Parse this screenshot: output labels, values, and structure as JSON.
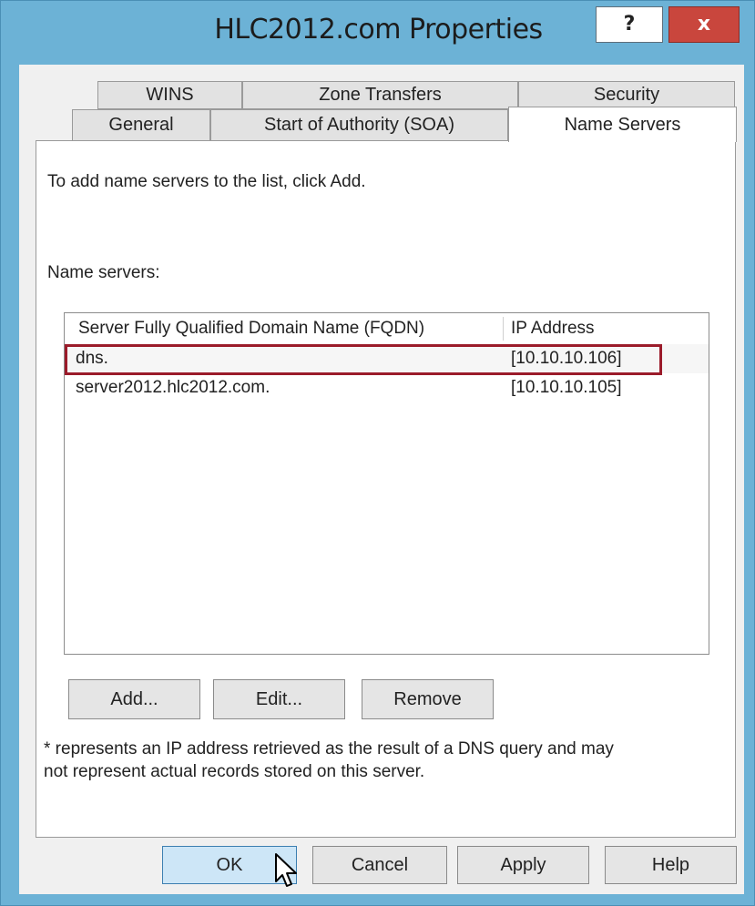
{
  "window": {
    "title": "HLC2012.com Properties",
    "help_label": "?",
    "close_label": "x"
  },
  "tabs": {
    "row1": [
      "WINS",
      "Zone Transfers",
      "Security"
    ],
    "row2": [
      "General",
      "Start of Authority (SOA)",
      "Name Servers"
    ],
    "selected": "Name Servers"
  },
  "panel": {
    "instruction": "To add name servers to the list, click Add.",
    "list_label": "Name servers:",
    "columns": [
      "Server Fully Qualified Domain Name (FQDN)",
      "IP Address"
    ],
    "rows": [
      {
        "fqdn": "dns.",
        "ip": "[10.10.10.106]",
        "selected": true
      },
      {
        "fqdn": "server2012.hlc2012.com.",
        "ip": "[10.10.10.105]",
        "selected": false
      }
    ],
    "buttons": {
      "add": "Add...",
      "edit": "Edit...",
      "remove": "Remove"
    },
    "note_line1": "* represents an IP address retrieved as the result of a DNS query and may",
    "note_line2": "not represent actual records stored on this server."
  },
  "footer": {
    "ok": "OK",
    "cancel": "Cancel",
    "apply": "Apply",
    "help": "Help"
  },
  "colors": {
    "title_bar": "#6cb2d6",
    "close_button": "#c9463d",
    "highlight_border": "#9b1b2a",
    "default_button": "#cde6f7"
  }
}
